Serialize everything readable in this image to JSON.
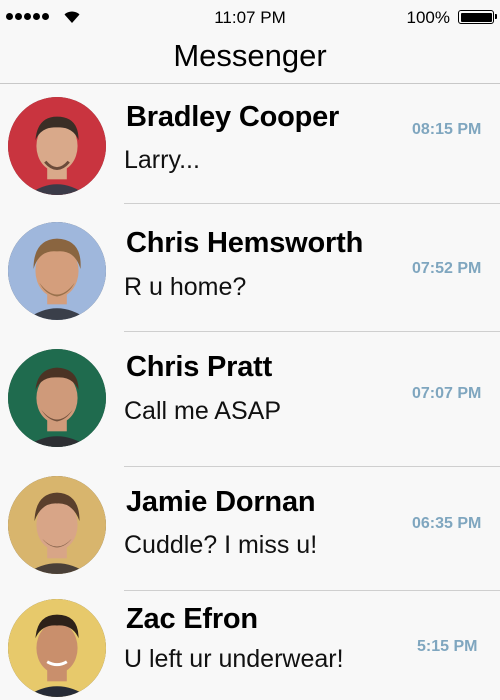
{
  "status_bar": {
    "time": "11:07 PM",
    "battery_percent_label": "100%",
    "battery_level": 1.0,
    "signal_bars": 5,
    "icons": [
      "signal-icon",
      "wifi-icon",
      "battery-icon"
    ]
  },
  "nav": {
    "title": "Messenger"
  },
  "colors": {
    "background": "#f8f8f8",
    "timestamp": "#7fa6bf",
    "divider": "#cfcfcf"
  },
  "conversations": [
    {
      "name": "Bradley Cooper",
      "preview": "Larry...",
      "time": "08:15 PM",
      "avatar_bg": "#c9343f",
      "avatar_skin": "#d9a98a",
      "avatar_hair": "#3a2e26"
    },
    {
      "name": "Chris Hemsworth",
      "preview": "R u home?",
      "time": "07:52 PM",
      "avatar_bg": "#9fb7dc",
      "avatar_skin": "#d49e7c",
      "avatar_hair": "#8a6540"
    },
    {
      "name": "Chris Pratt",
      "preview": "Call me ASAP",
      "time": "07:07 PM",
      "avatar_bg": "#1f6b4e",
      "avatar_skin": "#cf9a7a",
      "avatar_hair": "#4b3324"
    },
    {
      "name": "Jamie Dornan",
      "preview": "Cuddle? I miss u!",
      "time": "06:35 PM",
      "avatar_bg": "#d8b56d",
      "avatar_skin": "#d8a587",
      "avatar_hair": "#5a3f2c"
    },
    {
      "name": "Zac Efron",
      "preview": "U left ur underwear!",
      "time": "5:15 PM",
      "avatar_bg": "#e7c96b",
      "avatar_skin": "#c98f6c",
      "avatar_hair": "#2d2119"
    }
  ]
}
